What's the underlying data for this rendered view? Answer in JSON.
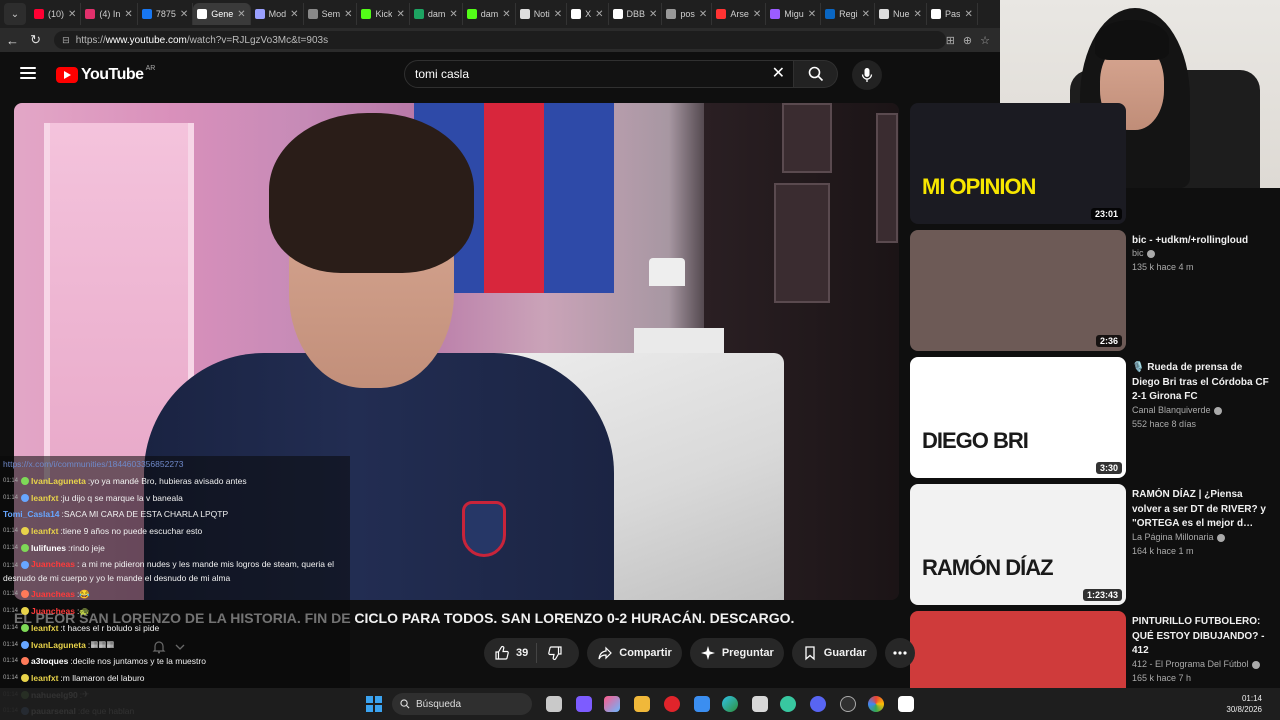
{
  "browser": {
    "tabs": [
      {
        "label": "(10)",
        "color": "#ff0033"
      },
      {
        "label": "(4) In",
        "color": "#e1306c"
      },
      {
        "label": "7875",
        "color": "#1877f2"
      },
      {
        "label": "Gene",
        "color": "#ffffff",
        "active": true
      },
      {
        "label": "Mod",
        "color": "#9aa0ff"
      },
      {
        "label": "Sem",
        "color": "#888888"
      },
      {
        "label": "Kick",
        "color": "#53fc18"
      },
      {
        "label": "dam",
        "color": "#1da462"
      },
      {
        "label": "dam",
        "color": "#53fc18"
      },
      {
        "label": "Noti",
        "color": "#dddddd"
      },
      {
        "label": "X",
        "color": "#ffffff"
      },
      {
        "label": "DBB",
        "color": "#ffffff"
      },
      {
        "label": "pos",
        "color": "#999999"
      },
      {
        "label": "Arse",
        "color": "#ff3333"
      },
      {
        "label": "Migu",
        "color": "#9b5cff"
      },
      {
        "label": "Regi",
        "color": "#0a66c2"
      },
      {
        "label": "Nue",
        "color": "#dddddd"
      },
      {
        "label": "Pas",
        "color": "#ffffff"
      }
    ],
    "url_prefix": "https://",
    "url_host": "www.youtube.com",
    "url_path": "/watch?v=RJLgzVo3Mc&t=903s"
  },
  "youtube": {
    "logo_text": "YouTube",
    "country_code": "AR",
    "search_value": "tomi casla"
  },
  "video": {
    "title": "EL PEOR SAN LORENZO DE LA HISTORIA. FIN DE CICLO PARA TODOS. SAN LORENZO 0-2 HURACÁN. DESCARGO.",
    "actions": {
      "likes": "39",
      "share": "Compartir",
      "ask": "Preguntar",
      "save": "Guardar"
    }
  },
  "chat": [
    {
      "time": "",
      "user": "",
      "text": "https://x.com/i/communities/1844603356852273",
      "style": "link"
    },
    {
      "time": "01:14",
      "user": "IvanLaguneta",
      "color": "u-yellow",
      "text": "yo ya mandé Bro, hubieras avisado antes"
    },
    {
      "time": "01:14",
      "user": "leanfxt",
      "color": "u-yellow",
      "text": "ju dijo q se marque la v baneala"
    },
    {
      "time": "",
      "user": "Tomi_Casla14",
      "color": "u-blue",
      "text": "SACA MI CARA DE ESTA CHARLA LPQTP"
    },
    {
      "time": "01:14",
      "user": "leanfxt",
      "color": "u-yellow",
      "text": "tiene 9 años no puede escuchar esto"
    },
    {
      "time": "01:14",
      "user": "lulifunes",
      "color": "u-white",
      "text": "rindo jeje"
    },
    {
      "time": "01:14",
      "user": "Juancheas",
      "color": "u-red",
      "text": "a mi me pidieron nudes y les mande mis logros de steam, queria el desnudo de mi cuerpo y yo le mande el desnudo de mi alma",
      "wrap": true
    },
    {
      "time": "01:14",
      "user": "Juancheas",
      "color": "u-red",
      "text": "😂"
    },
    {
      "time": "01:14",
      "user": "Juancheas",
      "color": "u-red",
      "text": "🐢"
    },
    {
      "time": "01:14",
      "user": "leanfxt",
      "color": "u-yellow",
      "text": "t haces el r boludo si pide"
    },
    {
      "time": "01:14",
      "user": "IvanLaguneta",
      "color": "u-yellow",
      "text": "▦▦▦"
    },
    {
      "time": "01:14",
      "user": "a3toques",
      "color": "u-white",
      "text": "decile nos juntamos y te la muestro"
    },
    {
      "time": "01:14",
      "user": "leanfxt",
      "color": "u-yellow",
      "text": "m llamaron del laburo"
    },
    {
      "time": "01:14",
      "user": "nahueelg90",
      "color": "u-white",
      "text": "✈"
    },
    {
      "time": "01:14",
      "user": "pauarsenal",
      "color": "u-white",
      "text": "de que hablan"
    }
  ],
  "recommendations": [
    {
      "title": "",
      "channel": "",
      "meta": "",
      "duration": "23:01",
      "thumb_text": "MI OPINION",
      "thumb_bg": "#1b1b22"
    },
    {
      "title": "bic - +udkm/+rollingloud",
      "channel": "bic",
      "meta": "135 k  hace 4 m",
      "duration": "2:36",
      "thumb_text": "",
      "thumb_bg": "#6d5a56"
    },
    {
      "title": "🎙️ Rueda de prensa de Diego Bri tras el Córdoba CF 2-1 Girona FC",
      "channel": "Canal Blanquiverde",
      "meta": "552  hace 8 días",
      "duration": "3:30",
      "thumb_text": "DIEGO BRI",
      "thumb_bg": "#ffffff"
    },
    {
      "title": "RAMÓN DÍAZ | ¿Piensa volver a ser DT de RIVER? y \"ORTEGA es el mejor d…",
      "channel": "La Página Millonaria",
      "meta": "164 k  hace 1 m",
      "duration": "1:23:43",
      "thumb_text": "RAMÓN DÍAZ",
      "thumb_bg": "#f2f2f2"
    },
    {
      "title": "PINTURILLO FUTBOLERO: QUÉ ESTOY DIBUJANDO? - 412",
      "channel": "412 - El Programa Del Fútbol",
      "meta": "165 k  hace 7 h",
      "duration": "",
      "thumb_text": "",
      "thumb_bg": "#cf3b3b"
    }
  ],
  "taskbar": {
    "search_label": "Búsqueda",
    "time": "01:14",
    "date": "30/8/2026"
  }
}
